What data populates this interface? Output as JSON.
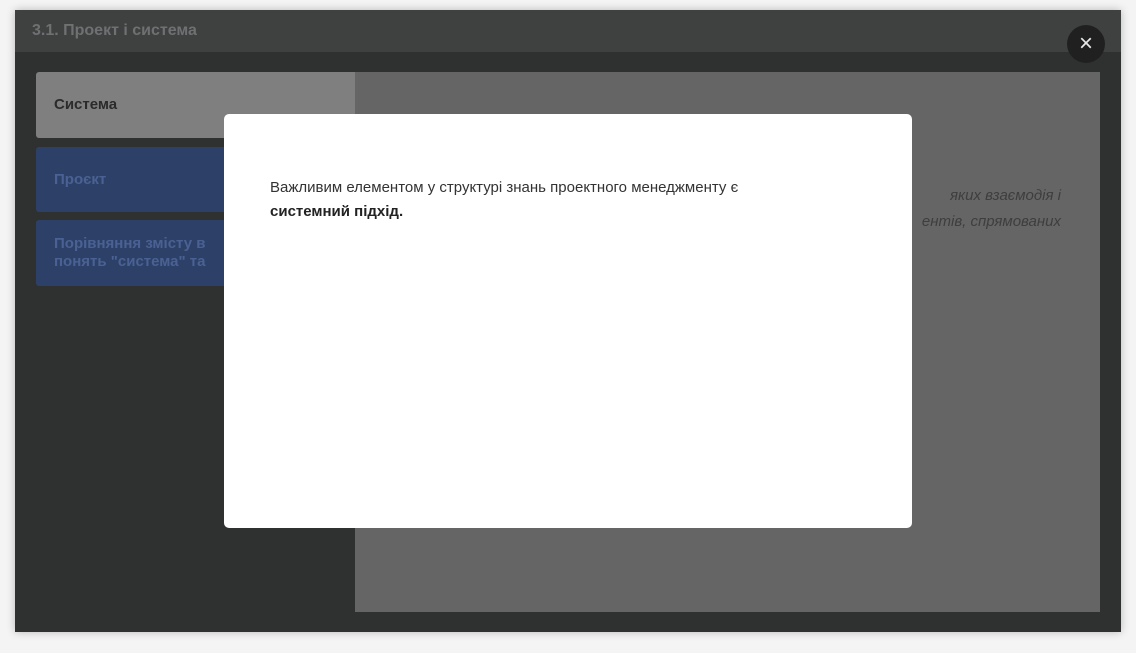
{
  "header": {
    "title": "3.1. Проект і система"
  },
  "tabs": [
    {
      "label": "Система"
    },
    {
      "label": "Проєкт"
    },
    {
      "label": "Порівняння змісту в\nпонять \"система\" та"
    }
  ],
  "content": {
    "partial_text": "яких взаємодія і\nентів, спрямованих"
  },
  "close_button": {
    "icon": "close-icon",
    "glyph": "×"
  },
  "modal": {
    "text_normal": "Важливим елементом у структурі знань проектного менеджменту є",
    "text_bold": "системний підхід."
  }
}
